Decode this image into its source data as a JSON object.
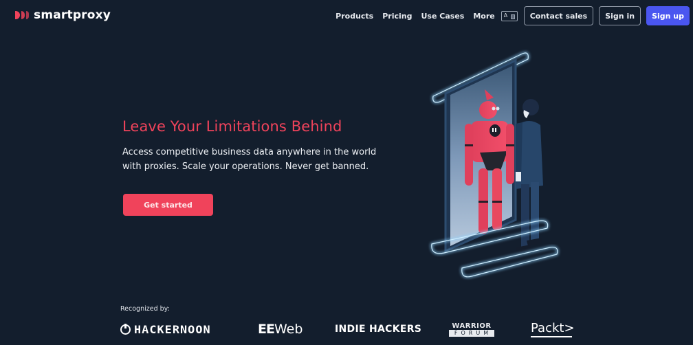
{
  "header": {
    "brand_name": "smartproxy",
    "nav": [
      {
        "label": "Products"
      },
      {
        "label": "Pricing"
      },
      {
        "label": "Use Cases"
      },
      {
        "label": "More"
      }
    ],
    "language_icon": {
      "glyph": "A",
      "name": "language-icon"
    },
    "contact_sales_label": "Contact sales",
    "sign_in_label": "Sign in",
    "sign_up_label": "Sign up"
  },
  "hero": {
    "title": "Leave Your Limitations Behind",
    "subtitle": "Access competitive business data anywhere in the world with proxies. Scale your operations. Never get banned.",
    "cta_label": "Get started",
    "illustration": "robot-in-mirror-illustration"
  },
  "recognized": {
    "label": "Recognized by:",
    "logos": [
      {
        "name": "HACKERNOON"
      },
      {
        "name_part1": "EE",
        "name_part2": "Web"
      },
      {
        "name": "INDIE HACKERS"
      },
      {
        "top": "WARRIOR",
        "bottom": "FORUM"
      },
      {
        "name": "Packt>"
      }
    ]
  },
  "colors": {
    "background": "#131e2d",
    "accent_red": "#f0435b",
    "accent_blue": "#4a56f0",
    "text": "#ffffff"
  }
}
